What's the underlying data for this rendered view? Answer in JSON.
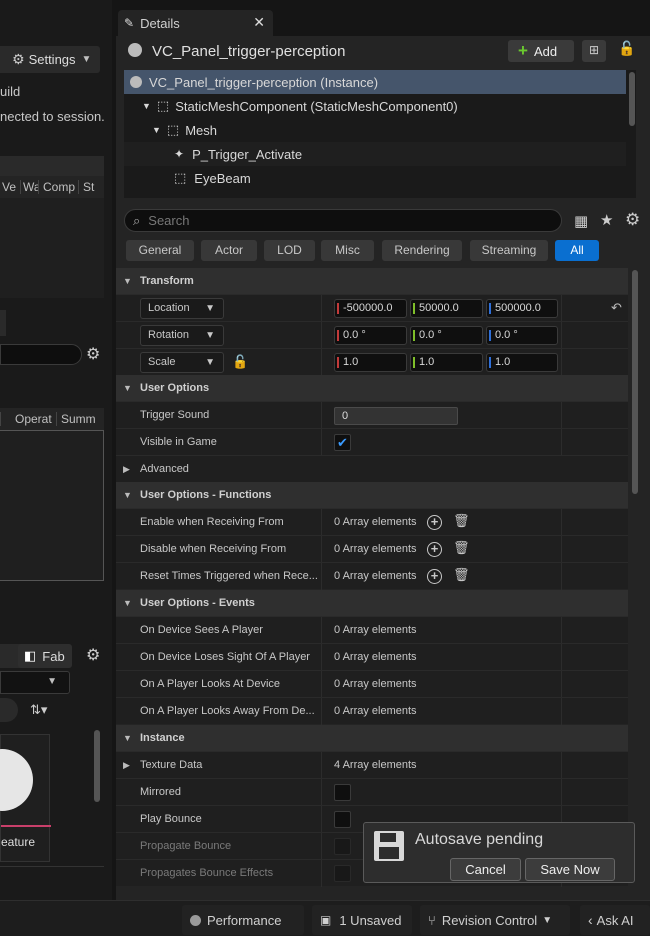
{
  "left": {
    "build_text": "uild",
    "settings_label": "Settings",
    "session_text": "nected to session.",
    "columns1": [
      "Ve",
      "Wa",
      "Comp",
      "St"
    ],
    "columns2": [
      "Operat",
      "Summ"
    ],
    "fab_label": "Fab",
    "thumb_label": "eature"
  },
  "details": {
    "tab_title": "Details",
    "actor_name": "VC_Panel_trigger-perception",
    "add_label": "Add",
    "tree": [
      {
        "label": "VC_Panel_trigger-perception (Instance)"
      },
      {
        "label": "StaticMeshComponent (StaticMeshComponent0)"
      },
      {
        "label": "Mesh"
      },
      {
        "label": "P_Trigger_Activate"
      },
      {
        "label": "EyeBeam"
      }
    ],
    "search_placeholder": "Search",
    "filters": [
      "General",
      "Actor",
      "LOD",
      "Misc",
      "Rendering",
      "Streaming",
      "All"
    ],
    "transform": {
      "title": "Transform",
      "location_label": "Location",
      "location": [
        "-500000.0",
        "50000.0",
        "500000.0"
      ],
      "rotation_label": "Rotation",
      "rotation": [
        "0.0 °",
        "0.0 °",
        "0.0 °"
      ],
      "scale_label": "Scale",
      "scale": [
        "1.0",
        "1.0",
        "1.0"
      ]
    },
    "user_options": {
      "title": "User Options",
      "trigger_sound_label": "Trigger Sound",
      "trigger_sound_value": "0",
      "visible_label": "Visible in Game",
      "advanced_label": "Advanced"
    },
    "functions": {
      "title": "User Options - Functions",
      "rows": [
        {
          "label": "Enable when Receiving From",
          "value": "0 Array elements"
        },
        {
          "label": "Disable when Receiving From",
          "value": "0 Array elements"
        },
        {
          "label": "Reset Times Triggered when Rece...",
          "value": "0 Array elements"
        }
      ]
    },
    "events": {
      "title": "User Options - Events",
      "rows": [
        {
          "label": "On Device Sees A Player",
          "value": "0 Array elements"
        },
        {
          "label": "On Device Loses Sight Of A Player",
          "value": "0 Array elements"
        },
        {
          "label": "On A Player Looks At Device",
          "value": "0 Array elements"
        },
        {
          "label": "On A Player Looks Away From De...",
          "value": "0 Array elements"
        }
      ]
    },
    "instance": {
      "title": "Instance",
      "texture_label": "Texture Data",
      "texture_value": "4 Array elements",
      "mirrored_label": "Mirrored",
      "play_bounce_label": "Play Bounce",
      "propagate_label": "Propagate Bounce",
      "propagates_effects_label": "Propagates Bounce Effects"
    }
  },
  "toast": {
    "title": "Autosave pending",
    "cancel_label": "Cancel",
    "save_label": "Save Now"
  },
  "statusbar": {
    "performance": "Performance",
    "unsaved": "1 Unsaved",
    "revision": "Revision Control",
    "ask_ai": "Ask AI"
  },
  "colors": {
    "accent": "#0a6fd0",
    "x_axis": "#c23a3a",
    "y_axis": "#7fbf2a",
    "z_axis": "#2f6fd8"
  }
}
